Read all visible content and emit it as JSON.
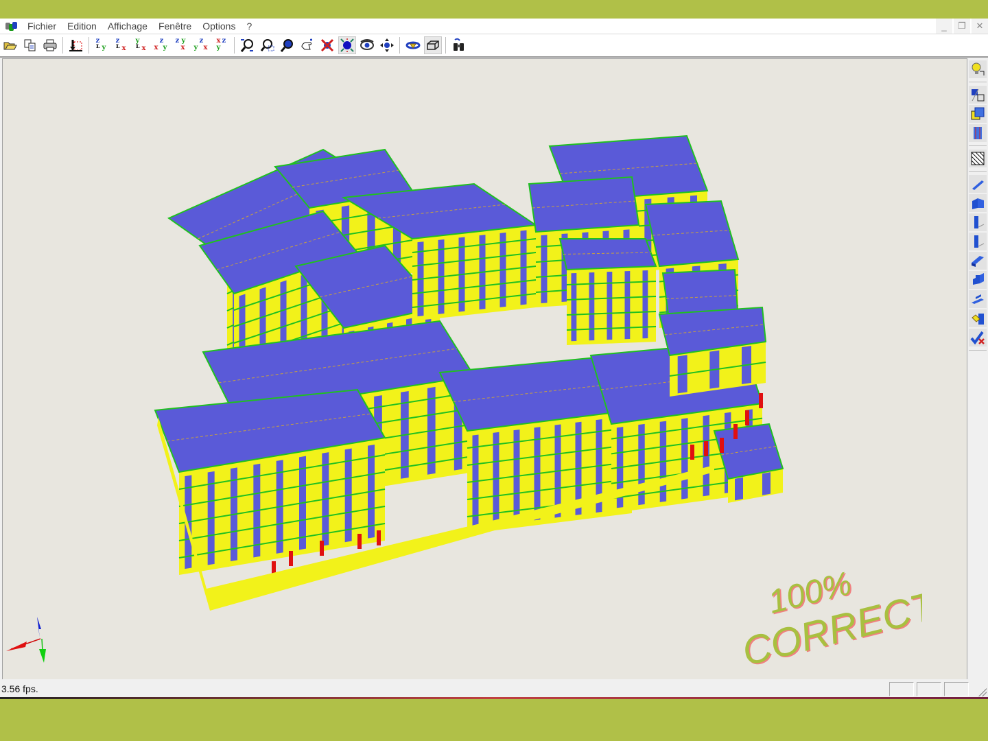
{
  "window": {
    "menu": [
      "Fichier",
      "Edition",
      "Affichage",
      "Fenêtre",
      "Options",
      "?"
    ],
    "controls": {
      "minimize": "_",
      "restore": "❐",
      "close": "✕"
    }
  },
  "toolbar": {
    "buttons": [
      {
        "name": "open-icon",
        "glyph": "📂"
      },
      {
        "name": "copy-icon",
        "glyph": "⎘"
      },
      {
        "name": "print-icon",
        "glyph": "🖶"
      },
      {
        "name": "section-icon",
        "glyph": "⤓"
      },
      {
        "name": "view-zy-icon",
        "top": "z",
        "bottom": "y"
      },
      {
        "name": "view-zx-icon",
        "top": "z",
        "bottom": "x"
      },
      {
        "name": "view-yx-icon",
        "top": "y",
        "bottom": "x"
      },
      {
        "name": "view-xzy-icon",
        "top": "z",
        "bottom": "xy"
      },
      {
        "name": "view-zyx-icon",
        "top": "zy",
        "bottom": "x"
      },
      {
        "name": "view-yzx-icon",
        "top": "z",
        "bottom": "yx"
      },
      {
        "name": "view-xzy2-icon",
        "top": "xz",
        "bottom": "y"
      },
      {
        "name": "zoom-in-icon",
        "glyph": "⌕"
      },
      {
        "name": "zoom-window-icon",
        "glyph": "⌕"
      },
      {
        "name": "zoom-icon",
        "glyph": "🔍"
      },
      {
        "name": "pan-hand-icon",
        "glyph": "☝"
      },
      {
        "name": "no-rotate-icon",
        "glyph": "✖"
      },
      {
        "name": "center-icon",
        "glyph": "✹"
      },
      {
        "name": "eye-icon",
        "glyph": "◉"
      },
      {
        "name": "move-icon",
        "glyph": "✥"
      },
      {
        "name": "orbit-icon",
        "glyph": "⟲"
      },
      {
        "name": "box-render-icon",
        "glyph": "▭"
      },
      {
        "name": "binoculars-icon",
        "glyph": "⛶"
      }
    ]
  },
  "sidebar": {
    "buttons": [
      "light-bulb-icon",
      "layers-toggle-icon",
      "plane-icon",
      "column-loads-icon",
      "mesh-icon",
      "beam-icon",
      "wall-icon",
      "column-icon",
      "column-2-icon",
      "slab-icon",
      "stair-icon",
      "foundation-icon",
      "footing-icon",
      "validate-icon"
    ]
  },
  "viewport": {
    "colors": {
      "background": "#e8e6df",
      "roof": "#5a5ad8",
      "wall": "#f2f21a",
      "wall_shade": "#c8c814",
      "beam": "#20c020",
      "column": "#e01010"
    },
    "stamp": {
      "line1": "100%",
      "line2": "CORRECT",
      "color": "#a8c040",
      "shadow": "#f08080"
    }
  },
  "status": {
    "fps": "3.56 fps."
  },
  "page": {
    "background": "#b0c048"
  }
}
